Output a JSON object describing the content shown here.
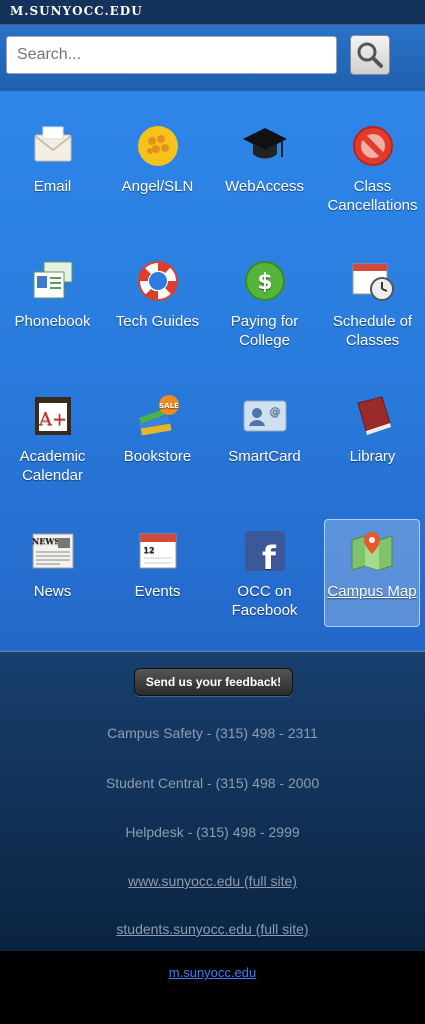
{
  "header": {
    "title": "M.SUNYOCC.EDU"
  },
  "search": {
    "placeholder": "Search..."
  },
  "tiles": [
    {
      "label": "Email",
      "icon": "email-icon"
    },
    {
      "label": "Angel/SLN",
      "icon": "angel-icon"
    },
    {
      "label": "WebAccess",
      "icon": "graduation-cap-icon"
    },
    {
      "label": "Class Cancellations",
      "icon": "no-entry-icon"
    },
    {
      "label": "Phonebook",
      "icon": "phonebook-icon"
    },
    {
      "label": "Tech Guides",
      "icon": "life-ring-icon"
    },
    {
      "label": "Paying for College",
      "icon": "dollar-icon"
    },
    {
      "label": "Schedule of Classes",
      "icon": "calendar-clock-icon"
    },
    {
      "label": "Academic Calendar",
      "icon": "a-plus-calendar-icon"
    },
    {
      "label": "Bookstore",
      "icon": "books-sale-icon"
    },
    {
      "label": "SmartCard",
      "icon": "id-card-icon"
    },
    {
      "label": "Library",
      "icon": "book-icon"
    },
    {
      "label": "News",
      "icon": "newspaper-icon"
    },
    {
      "label": "Events",
      "icon": "calendar-icon"
    },
    {
      "label": "OCC on Facebook",
      "icon": "facebook-icon"
    },
    {
      "label": "Campus Map",
      "icon": "map-icon"
    }
  ],
  "footer": {
    "feedback_label": "Send us your feedback!",
    "safety": "Campus Safety - (315) 498 - 2311",
    "student_central": "Student Central - (315) 498 - 2000",
    "helpdesk": "Helpdesk - (315) 498 - 2999",
    "full_site": "www.sunyocc.edu (full site)",
    "students_site": "students.sunyocc.edu (full site)"
  },
  "bottom": {
    "link": "m.sunyocc.edu"
  }
}
